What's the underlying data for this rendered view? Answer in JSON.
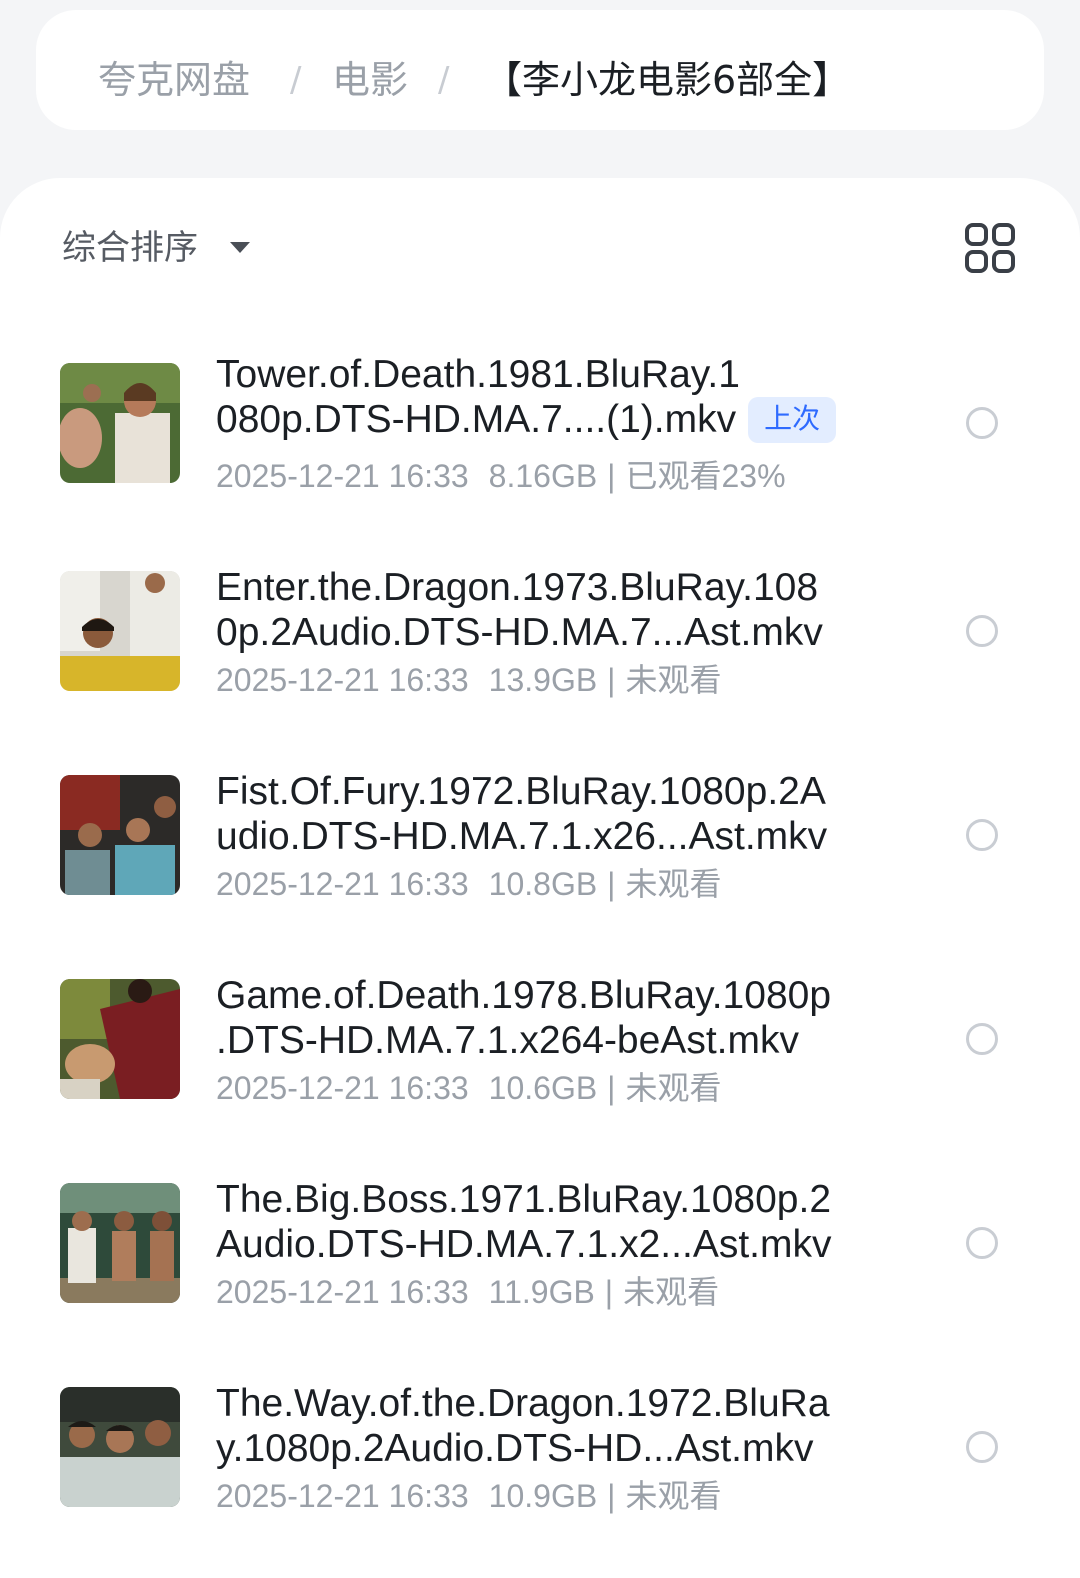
{
  "breadcrumb": {
    "root": "夸克网盘",
    "folder": "电影",
    "current": "【李小龙电影6部全】",
    "separator": "/"
  },
  "toolbar": {
    "sort_label": "综合排序",
    "view_toggle_icon": "grid-view-icon"
  },
  "badge_color": "#2f6bff",
  "files": [
    {
      "title_lines": [
        "Tower.of.Death.1981.BluRay.1",
        "080p.DTS-HD.MA.7....(1).mkv"
      ],
      "badge": "上次",
      "date": "2025-12-21 16:33",
      "size": "8.16GB",
      "status": "已观看23%",
      "watched_fraction": 0.23
    },
    {
      "title_lines": [
        "Enter.the.Dragon.1973.BluRay.108",
        "0p.2Audio.DTS-HD.MA.7...Ast.mkv"
      ],
      "date": "2025-12-21 16:33",
      "size": "13.9GB",
      "status": "未观看"
    },
    {
      "title_lines": [
        "Fist.Of.Fury.1972.BluRay.1080p.2A",
        "udio.DTS-HD.MA.7.1.x26...Ast.mkv"
      ],
      "date": "2025-12-21 16:33",
      "size": "10.8GB",
      "status": "未观看"
    },
    {
      "title_lines": [
        "Game.of.Death.1978.BluRay.1080p",
        ".DTS-HD.MA.7.1.x264-beAst.mkv"
      ],
      "date": "2025-12-21 16:33",
      "size": "10.6GB",
      "status": "未观看"
    },
    {
      "title_lines": [
        "The.Big.Boss.1971.BluRay.1080p.2",
        "Audio.DTS-HD.MA.7.1.x2...Ast.mkv"
      ],
      "date": "2025-12-21 16:33",
      "size": "11.9GB",
      "status": "未观看"
    },
    {
      "title_lines": [
        "The.Way.of.the.Dragon.1972.BluRa",
        "y.1080p.2Audio.DTS-HD...Ast.mkv"
      ],
      "date": "2025-12-21 16:33",
      "size": "10.9GB",
      "status": "未观看"
    }
  ]
}
